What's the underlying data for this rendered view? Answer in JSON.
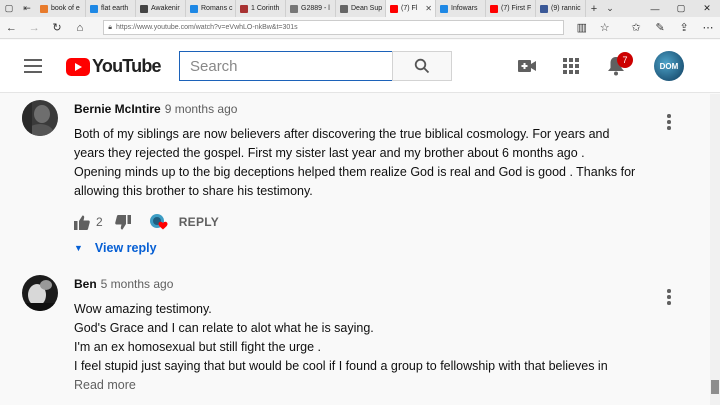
{
  "browser": {
    "tabs": [
      {
        "label": "book of e",
        "color": "#e87b2c"
      },
      {
        "label": "flat earth",
        "color": "#1e88e5"
      },
      {
        "label": "Awakenir",
        "color": "#444444"
      },
      {
        "label": "Romans c",
        "color": "#1e88e5"
      },
      {
        "label": "1 Corinth",
        "color": "#a83232"
      },
      {
        "label": "G2889 - l",
        "color": "#777777"
      },
      {
        "label": "Dean Sup",
        "color": "#666666"
      },
      {
        "label": "(7) Fl",
        "color": "#ff0000",
        "active": true
      },
      {
        "label": "Infowars",
        "color": "#1e88e5"
      },
      {
        "label": "(7) First F",
        "color": "#ff0000"
      },
      {
        "label": "(9) rannic",
        "color": "#3b5998"
      }
    ],
    "url": "https://www.youtube.com/watch?v=eVwhLO-nkBw&t=301s"
  },
  "header": {
    "logo_text": "YouTube",
    "search_placeholder": "Search",
    "notification_count": "7",
    "avatar_text": "DOM"
  },
  "comments": [
    {
      "author": "Bernie McIntire",
      "time": "9 months ago",
      "lines": [
        "Both of my siblings are now believers after discovering the true biblical cosmology. For years and",
        "years they rejected the gospel. First my sister last year and my brother about 6 months ago .",
        "Opening minds up to the big deceptions helped them realize God is real and God is good . Thanks for",
        "allowing this brother to share his testimony."
      ],
      "likes": "2",
      "reply_label": "REPLY",
      "view_reply": "View reply"
    },
    {
      "author": "Ben",
      "time": "5 months ago",
      "lines": [
        "Wow amazing testimony.",
        "God's Grace and I can relate to alot what he is saying.",
        "I'm an ex homosexual but still fight the urge .",
        "I feel stupid just saying that but would be cool if I found a group to fellowship with that believes in"
      ],
      "read_more": "Read more"
    }
  ],
  "colors": {
    "brand_red": "#ff0000",
    "link_blue": "#065fd4",
    "search_border": "#1c62b9"
  }
}
